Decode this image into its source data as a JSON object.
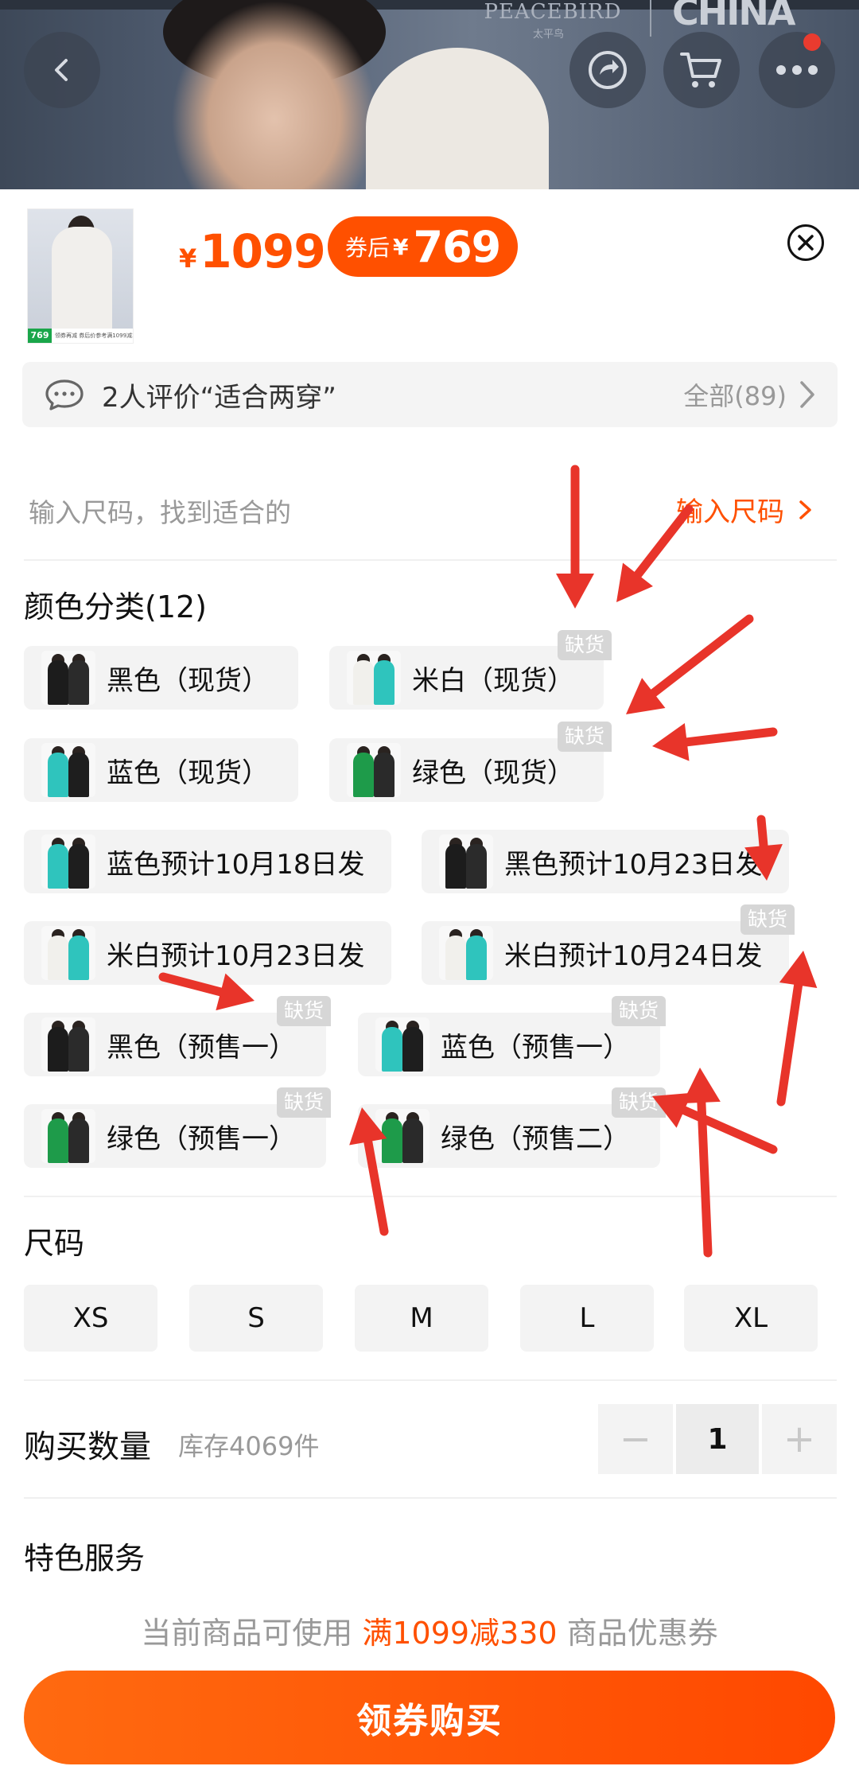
{
  "banner": {
    "brand_name": "PEACEBIRD",
    "brand_sub": "太平鸟",
    "brand_partner": "CHINA"
  },
  "icons": {
    "back": "chevron-left-icon",
    "share": "share-icon",
    "cart": "cart-icon",
    "more": "more-icon",
    "close": "close-icon",
    "chat": "chat-icon",
    "chevron_right": "chevron-right-icon"
  },
  "product": {
    "thumb_badge": "769",
    "thumb_caption": "领券再减 券后价参考满1099减330元",
    "price_currency": "¥",
    "price": "1099",
    "coupon_label": "券后",
    "coupon_currency": "¥",
    "coupon_price": "769"
  },
  "reviews": {
    "text": "2人评价“适合两穿”",
    "all_label": "全部(89)"
  },
  "size_finder": {
    "hint": "输入尺码，找到适合的",
    "link_label": "输入尺码"
  },
  "color": {
    "title": "颜色分类(12)",
    "out_of_stock_label": "缺货",
    "options": [
      {
        "label": "黑色（现货）",
        "tone": "black",
        "out_of_stock": false
      },
      {
        "label": "米白（现货）",
        "tone": "white",
        "out_of_stock": true
      },
      {
        "label": "蓝色（现货）",
        "tone": "blue",
        "out_of_stock": false
      },
      {
        "label": "绿色（现货）",
        "tone": "green",
        "out_of_stock": true
      },
      {
        "label": "蓝色预计10月18日发",
        "tone": "blue",
        "out_of_stock": false
      },
      {
        "label": "黑色预计10月23日发",
        "tone": "black",
        "out_of_stock": false
      },
      {
        "label": "米白预计10月23日发",
        "tone": "white",
        "out_of_stock": false
      },
      {
        "label": "米白预计10月24日发",
        "tone": "white",
        "out_of_stock": true
      },
      {
        "label": "黑色（预售一）",
        "tone": "black",
        "out_of_stock": true
      },
      {
        "label": "蓝色（预售一）",
        "tone": "blue",
        "out_of_stock": true
      },
      {
        "label": "绿色（预售一）",
        "tone": "green",
        "out_of_stock": true
      },
      {
        "label": "绿色（预售二）",
        "tone": "green",
        "out_of_stock": true
      }
    ]
  },
  "size": {
    "title": "尺码",
    "options": [
      "XS",
      "S",
      "M",
      "L",
      "XL"
    ]
  },
  "quantity": {
    "title": "购买数量",
    "stock": "库存4069件",
    "value": "1",
    "minus": "−",
    "plus": "+"
  },
  "services": {
    "title": "特色服务"
  },
  "coupon_note": {
    "prefix": "当前商品可使用",
    "highlight": "满1099减330",
    "suffix": "商品优惠券"
  },
  "buy_button": {
    "label": "领券购买"
  },
  "colors": {
    "accent": "#ff5000",
    "annotation_arrow": "#e8342a",
    "out_of_stock_tag": "#d6d6d6"
  }
}
